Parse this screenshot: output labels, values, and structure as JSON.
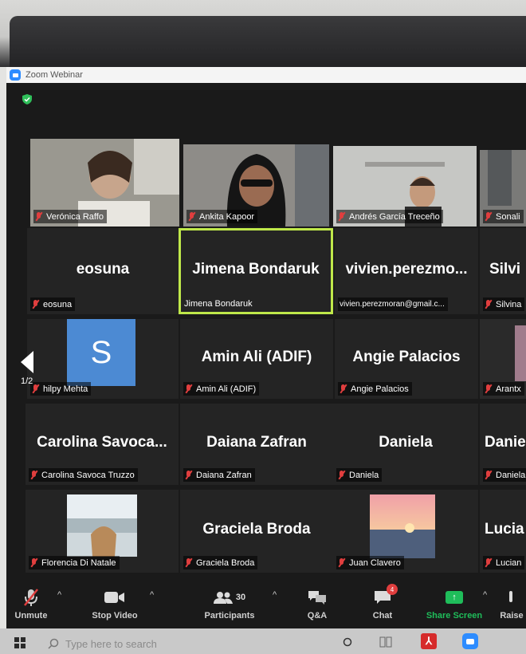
{
  "window": {
    "title": "Zoom Webinar"
  },
  "gallery": {
    "page_indicator": "1/2",
    "tiles": [
      {
        "center": "",
        "label": "Verónica Raffo",
        "muted": true
      },
      {
        "center": "",
        "label": "Ankita Kapoor",
        "muted": true
      },
      {
        "center": "",
        "label": "Andrés García Treceño",
        "muted": true
      },
      {
        "center": "",
        "label": "Sonali",
        "muted": true
      },
      {
        "center": "eosuna",
        "label": "eosuna",
        "muted": true
      },
      {
        "center": "Jimena Bondaruk",
        "label": "Jimena Bondaruk",
        "muted": false,
        "active_speaker": true
      },
      {
        "center": "vivien.perezmo...",
        "label": "vivien.perezmoran@gmail.c...",
        "muted": false
      },
      {
        "center": "Silvi",
        "label": "Silvina",
        "muted": true
      },
      {
        "center": "",
        "label": "hilpy Mehta",
        "muted": true,
        "avatar_letter": "S"
      },
      {
        "center": "Amin Ali (ADIF)",
        "label": "Amin Ali (ADIF)",
        "muted": true
      },
      {
        "center": "Angie Palacios",
        "label": "Angie Palacios",
        "muted": true
      },
      {
        "center": "",
        "label": "Arantx",
        "muted": true
      },
      {
        "center": "Carolina  Savoca...",
        "label": "Carolina Savoca Truzzo",
        "muted": true
      },
      {
        "center": "Daiana Zafran",
        "label": "Daiana Zafran",
        "muted": true
      },
      {
        "center": "Daniela",
        "label": "Daniela",
        "muted": true
      },
      {
        "center": "Danie",
        "label": "Daniela",
        "muted": true
      },
      {
        "center": "",
        "label": "Florencia Di Natale",
        "muted": true
      },
      {
        "center": "Graciela Broda",
        "label": "Graciela Broda",
        "muted": true
      },
      {
        "center": "",
        "label": "Juan Clavero",
        "muted": true
      },
      {
        "center": "Lucia",
        "label": "Lucian",
        "muted": true
      }
    ]
  },
  "toolbar": {
    "unmute": "Unmute",
    "stop_video": "Stop Video",
    "participants": "Participants",
    "participants_count": "30",
    "qa": "Q&A",
    "chat": "Chat",
    "chat_badge": "4",
    "share_screen": "Share Screen",
    "raise": "Raise"
  },
  "taskbar": {
    "search_placeholder": "Type here to search"
  },
  "colors": {
    "active_speaker": "#bfe84a",
    "share": "#1fbd5a",
    "zoom_blue": "#2d8cff",
    "muted_red": "#e03e3e"
  }
}
